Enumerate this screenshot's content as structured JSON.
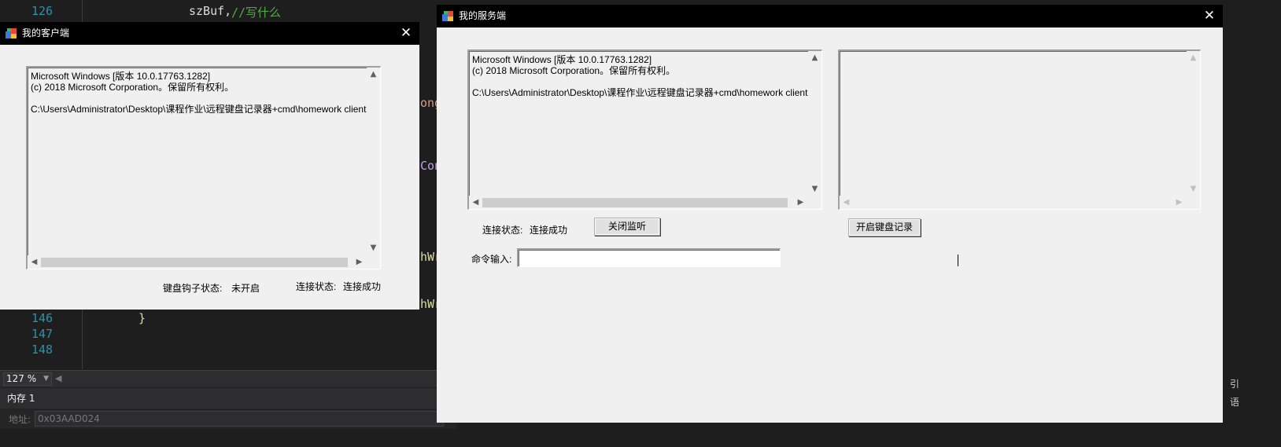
{
  "ide": {
    "line_numbers": [
      "126",
      "146",
      "147",
      "148"
    ],
    "code_fragments": [
      {
        "text": "szBuf,",
        "cls": "c-white"
      },
      {
        "text": "//写什么",
        "cls": "c-green"
      },
      {
        "text": "ong",
        "cls": "c-orange"
      },
      {
        "text": "Con",
        "cls": "c-purple"
      },
      {
        "text": "hWr",
        "cls": "c-yellow"
      },
      {
        "text": "hWr",
        "cls": "c-yellow"
      },
      {
        "text": "}",
        "cls": "c-yellow"
      }
    ],
    "zoom_level": "127 %",
    "memory_panel_title": "内存 1",
    "address_label": "地址:",
    "address_value": "0x03AAD024",
    "right_glyphs": [
      "引",
      "语"
    ]
  },
  "client_window": {
    "title": "我的客户端",
    "console_lines": "Microsoft Windows [版本 10.0.17763.1282]\n(c) 2018 Microsoft Corporation。保留所有权利。\n\nC:\\Users\\Administrator\\Desktop\\课程作业\\远程键盘记录器+cmd\\homework client",
    "hook_status_label": "键盘钩子状态:",
    "hook_status_value": "未开启",
    "connection_status_label": "连接状态:",
    "connection_status_value": "连接成功"
  },
  "server_window": {
    "title": "我的服务端",
    "console_lines": "Microsoft Windows [版本 10.0.17763.1282]\n(c) 2018 Microsoft Corporation。保留所有权利。\n\nC:\\Users\\Administrator\\Desktop\\课程作业\\远程键盘记录器+cmd\\homework client",
    "keylog_text": "",
    "connection_status_label": "连接状态:",
    "connection_status_value": "连接成功",
    "stop_listen_button": "关闭监听",
    "start_keylog_button": "开启键盘记录",
    "command_label": "命令输入:",
    "command_value": ""
  },
  "icons": {
    "close": "✕",
    "up": "▲",
    "down": "▼",
    "left": "◀",
    "right": "▶"
  }
}
